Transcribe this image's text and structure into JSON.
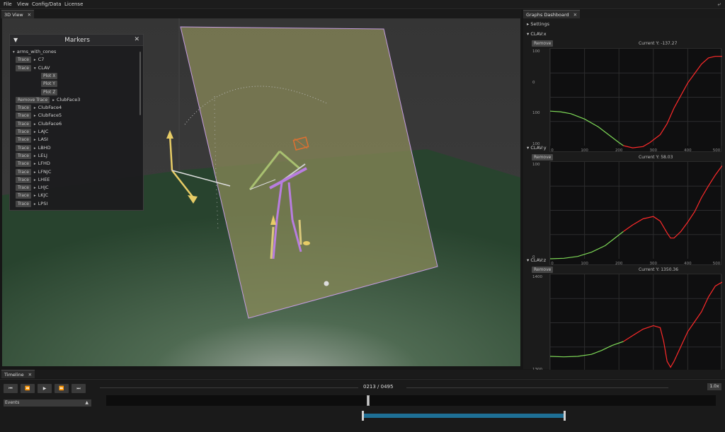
{
  "menu": [
    "File",
    "View",
    "Config/Data",
    "License"
  ],
  "tabs": {
    "view3d": "3D View",
    "graphs": "Graphs Dashboard",
    "timeline": "Timeline"
  },
  "markers_panel": {
    "title": "Markers",
    "root": "arms_with_cones",
    "trace_label": "Trace",
    "remove_trace_label": "Remove Trace",
    "plot_labels": [
      "Plot X",
      "Plot Y",
      "Plot Z"
    ],
    "items_before": [
      "C7",
      "CLAV"
    ],
    "clubface3": "ClubFace3",
    "items_after": [
      "ClubFace4",
      "ClubFace5",
      "ClubFace6",
      "LAJC",
      "LASI",
      "LBHD",
      "LELJ",
      "LFHD",
      "LFNJC",
      "LHEE",
      "LHJC",
      "LKJC",
      "LPSI"
    ]
  },
  "graphs_panel": {
    "settings": "Settings",
    "remove_label": "Remove",
    "graphs": [
      {
        "title": "CLAV:x",
        "current": "Current Y: -137.27"
      },
      {
        "title": "CLAV:y",
        "current": "Current Y: 58.03"
      },
      {
        "title": "CLAV:z",
        "current": "Current Y: 1350.36"
      }
    ]
  },
  "chart_data": [
    {
      "type": "line",
      "title": "CLAV:x",
      "xlim": [
        0,
        500
      ],
      "ylim": [
        -130,
        170
      ],
      "xticks": [
        "0",
        "100",
        "200",
        "300",
        "400",
        "500"
      ],
      "yticks": [
        "100",
        "0",
        "100",
        "100"
      ],
      "series": [
        {
          "color": "#7ed957",
          "x": [
            0,
            30,
            60,
            100,
            140,
            170,
            200,
            213
          ],
          "y": [
            -20,
            -22,
            -28,
            -45,
            -70,
            -95,
            -120,
            -130
          ]
        },
        {
          "color": "#ff2a2a",
          "x": [
            213,
            240,
            270,
            290,
            320,
            340,
            360,
            380,
            400,
            420,
            440,
            460,
            480,
            500
          ],
          "y": [
            -130,
            -137,
            -133,
            -120,
            -95,
            -60,
            -10,
            30,
            70,
            100,
            130,
            150,
            155,
            155
          ]
        }
      ]
    },
    {
      "type": "line",
      "title": "CLAV:y",
      "xlim": [
        0,
        500
      ],
      "ylim": [
        0,
        200
      ],
      "xticks": [
        "0",
        "100",
        "200",
        "300",
        "400",
        "500"
      ],
      "yticks": [
        "100",
        "0"
      ],
      "series": [
        {
          "color": "#7ed957",
          "x": [
            0,
            40,
            80,
            120,
            160,
            190,
            213
          ],
          "y": [
            0,
            1,
            5,
            14,
            28,
            45,
            58
          ]
        },
        {
          "color": "#ff2a2a",
          "x": [
            213,
            240,
            270,
            300,
            320,
            340,
            350,
            360,
            380,
            400,
            420,
            440,
            460,
            480,
            500
          ],
          "y": [
            58,
            72,
            85,
            90,
            80,
            55,
            44,
            44,
            58,
            78,
            100,
            130,
            155,
            178,
            198
          ]
        }
      ]
    },
    {
      "type": "line",
      "title": "CLAV:z",
      "xlim": [
        0,
        500
      ],
      "ylim": [
        1290,
        1480
      ],
      "xticks": [
        "0",
        "100",
        "200",
        "300",
        "400",
        "500"
      ],
      "yticks": [
        "1400",
        "1300"
      ],
      "series": [
        {
          "color": "#7ed957",
          "x": [
            0,
            40,
            80,
            120,
            150,
            180,
            213
          ],
          "y": [
            1320,
            1319,
            1320,
            1324,
            1332,
            1342,
            1350
          ]
        },
        {
          "color": "#ff2a2a",
          "x": [
            213,
            240,
            270,
            300,
            320,
            330,
            340,
            350,
            360,
            380,
            400,
            420,
            440,
            460,
            480,
            500
          ],
          "y": [
            1350,
            1362,
            1375,
            1382,
            1378,
            1350,
            1310,
            1298,
            1310,
            1340,
            1370,
            1390,
            1410,
            1440,
            1462,
            1470
          ]
        }
      ]
    }
  ],
  "timeline": {
    "frame": "0213 / 0495",
    "speed": "1.0x",
    "events_label": "Events"
  },
  "colors": {
    "accent": "#1e6f95",
    "series_green": "#7ed957",
    "series_red": "#ff2a2a",
    "skeleton": "#b87de0",
    "plane": "#8c8c5a"
  }
}
